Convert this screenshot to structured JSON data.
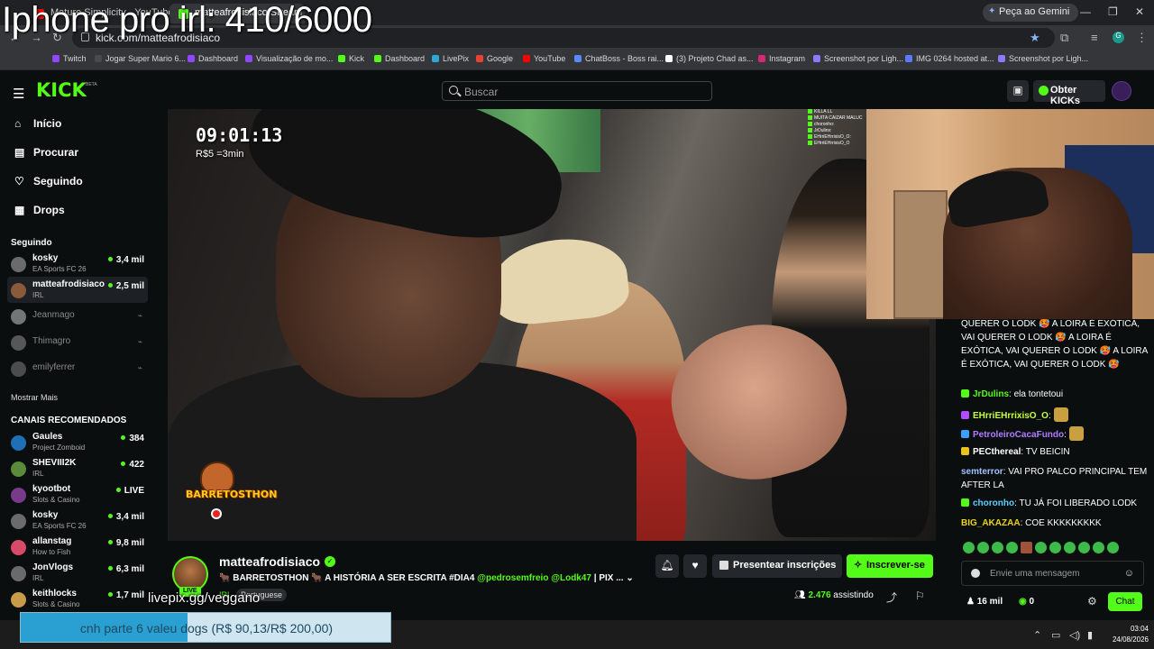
{
  "overlay": {
    "title": "Iphone pro irl: 410/6000"
  },
  "browser": {
    "tabs": [
      {
        "label": "Mature Simplicity - YouTube"
      },
      {
        "label": "matteafrodisiaco Stream - Kick"
      }
    ],
    "gemini": "Peça ao Gemini",
    "url": "kick.com/matteafrodisiaco",
    "bookmarks": [
      "Twitch",
      "Jogar Super Mario 6...",
      "Dashboard",
      "Visualização de mo...",
      "Kick",
      "Dashboard",
      "LivePix",
      "Google",
      "YouTube",
      "ChatBoss - Boss rai...",
      "(3) Projeto Chad as...",
      "Instagram",
      "Screenshot por Ligh...",
      "IMG 0264 hosted at...",
      "Screenshot por Ligh..."
    ]
  },
  "header": {
    "logo": "KICK",
    "beta": "BETA",
    "search_placeholder": "Buscar",
    "get_kicks": "Obter KICKs"
  },
  "sidebar": {
    "nav": [
      {
        "label": "Início",
        "icon": "home-icon"
      },
      {
        "label": "Procurar",
        "icon": "browse-icon"
      },
      {
        "label": "Seguindo",
        "icon": "heart-icon"
      },
      {
        "label": "Drops",
        "icon": "drops-icon"
      }
    ],
    "following_title": "Seguindo",
    "following": [
      {
        "name": "kosky",
        "game": "EA Sports FC 26",
        "viewers": "3,4 mil",
        "color": "#6b6b6b"
      },
      {
        "name": "matteafrodisiaco",
        "game": "IRL",
        "viewers": "2,5 mil",
        "color": "#8a5a3a"
      },
      {
        "name": "Jeanmago",
        "color": "#bbbbbb"
      },
      {
        "name": "Thimagro",
        "color": "#888888"
      },
      {
        "name": "emilyferrer",
        "color": "#777777"
      }
    ],
    "show_more": "Mostrar Mais",
    "recommended_title": "CANAIS RECOMENDADOS",
    "recommended": [
      {
        "name": "Gaules",
        "game": "Project Zomboid",
        "viewers": "384",
        "color": "#1f6fb5"
      },
      {
        "name": "SHEVIII2K",
        "game": "IRL",
        "viewers": "422",
        "color": "#5a8a3a"
      },
      {
        "name": "kyootbot",
        "game": "Slots & Casino",
        "viewers": "LIVE",
        "color": "#7a3a8a"
      },
      {
        "name": "kosky",
        "game": "EA Sports FC 26",
        "viewers": "3,4 mil",
        "color": "#6b6b6b"
      },
      {
        "name": "allanstag",
        "game": "How to Fish",
        "viewers": "9,8 mil",
        "color": "#d84a6a"
      },
      {
        "name": "JonVlogs",
        "game": "IRL",
        "viewers": "6,3 mil",
        "color": "#6a6a6a"
      },
      {
        "name": "keithlocks",
        "game": "Slots & Casino",
        "viewers": "1,7 mil",
        "color": "#c99a4a"
      }
    ]
  },
  "video": {
    "timer": "09:01:13",
    "rate": "R$5 =3min",
    "logo_text": "BARRETOSTHON",
    "mini_chat": [
      "KILLA LL",
      "MUITA CAIZAR MALUC",
      "choronho: ",
      "JrDulins:",
      "EHrriEHrrixisO_O:",
      "EHrriEHrrixisO_O"
    ]
  },
  "chat": {
    "messages": [
      {
        "user": "",
        "text": "QUERER O LODK 🥵 A LOIRA É EXÓTICA, VAI QUERER O LODK 🥵 A LOIRA É EXÓTICA, VAI QUERER O LODK 🥵 A LOIRA É EXÓTICA, VAI QUERER O LODK 🥵",
        "color": "#ffffff",
        "badge": ""
      },
      {
        "user": "JrDulins",
        "text": "ela tontetoui",
        "color": "#53fc18",
        "badge": "#53fc18"
      },
      {
        "user": "EHrriEHrrixisO_O",
        "text": "",
        "color": "#c7ff3a",
        "badge": "#b04cff"
      },
      {
        "user": "PetroleiroCacaFundo",
        "text": "",
        "color": "#b07cff",
        "badge": "#3aa0ff"
      },
      {
        "user": "PECthereal",
        "text": "TV BEICIN",
        "color": "#ffffff",
        "badge": "#e9c21c"
      },
      {
        "user": "semterror",
        "text": "VAI PRO PALCO PRINCIPAL TEM AFTER LA",
        "color": "#9fc2ff",
        "badge": ""
      },
      {
        "user": "choronho",
        "text": "TU JÁ FOI LIBERADO LODK",
        "color": "#5ad0ff",
        "badge": "#53fc18"
      },
      {
        "user": "BIG_AKAZAA",
        "text": "COE KKKKKKKKK",
        "color": "#e9d31c",
        "badge": ""
      }
    ],
    "input_placeholder": "Envie uma mensagem",
    "likes": "16 mil",
    "kicks": "0",
    "chat_button": "Chat"
  },
  "stream": {
    "streamer": "matteafrodisiaco",
    "live": "LIVE",
    "title_prefix": "🐂 BARRETOSTHON 🐂 A HISTÓRIA A SER ESCRITA #DIA4 ",
    "mention1": "@pedrosemfreio",
    "mention2": "@Lodk47",
    "title_suffix": " | PIX ...",
    "category": "IRL",
    "language": "Portuguese",
    "gift_label": "Presentear inscrições",
    "subscribe_label": "Inscrever-se",
    "viewers": "2.476",
    "viewers_label": "assistindo",
    "livepix": "livepix.gg/veggano"
  },
  "goal": {
    "text": "cnh parte 6 valeu dogs (R$ 90,13/R$ 200,00)",
    "current": 90.13,
    "target": 200.0
  },
  "taskbar": {
    "time": "03:04",
    "date": "24/08/2026"
  }
}
